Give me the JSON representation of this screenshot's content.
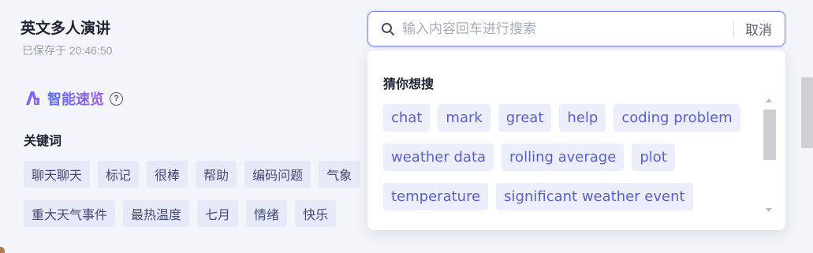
{
  "document": {
    "title": "英文多人演讲",
    "saved_status": "已保存于 20:46:50"
  },
  "smart_overview": {
    "label": "智能速览",
    "help_glyph": "?",
    "icon": "ai-sparkle-icon"
  },
  "keywords": {
    "heading": "关键词",
    "rows": [
      [
        "聊天聊天",
        "标记",
        "很棒",
        "帮助",
        "编码问题",
        "气象"
      ],
      [
        "重大天气事件",
        "最热温度",
        "七月",
        "情绪",
        "快乐"
      ]
    ]
  },
  "search": {
    "placeholder": "输入内容回车进行搜索",
    "value": "",
    "cancel_label": "取消",
    "accent_color": "#7b82ef"
  },
  "suggestions": {
    "heading": "猜你想搜",
    "rows": [
      [
        "chat",
        "mark",
        "great",
        "help",
        "coding problem"
      ],
      [
        "weather data",
        "rolling average",
        "plot"
      ],
      [
        "temperature",
        "significant weather event"
      ]
    ]
  }
}
